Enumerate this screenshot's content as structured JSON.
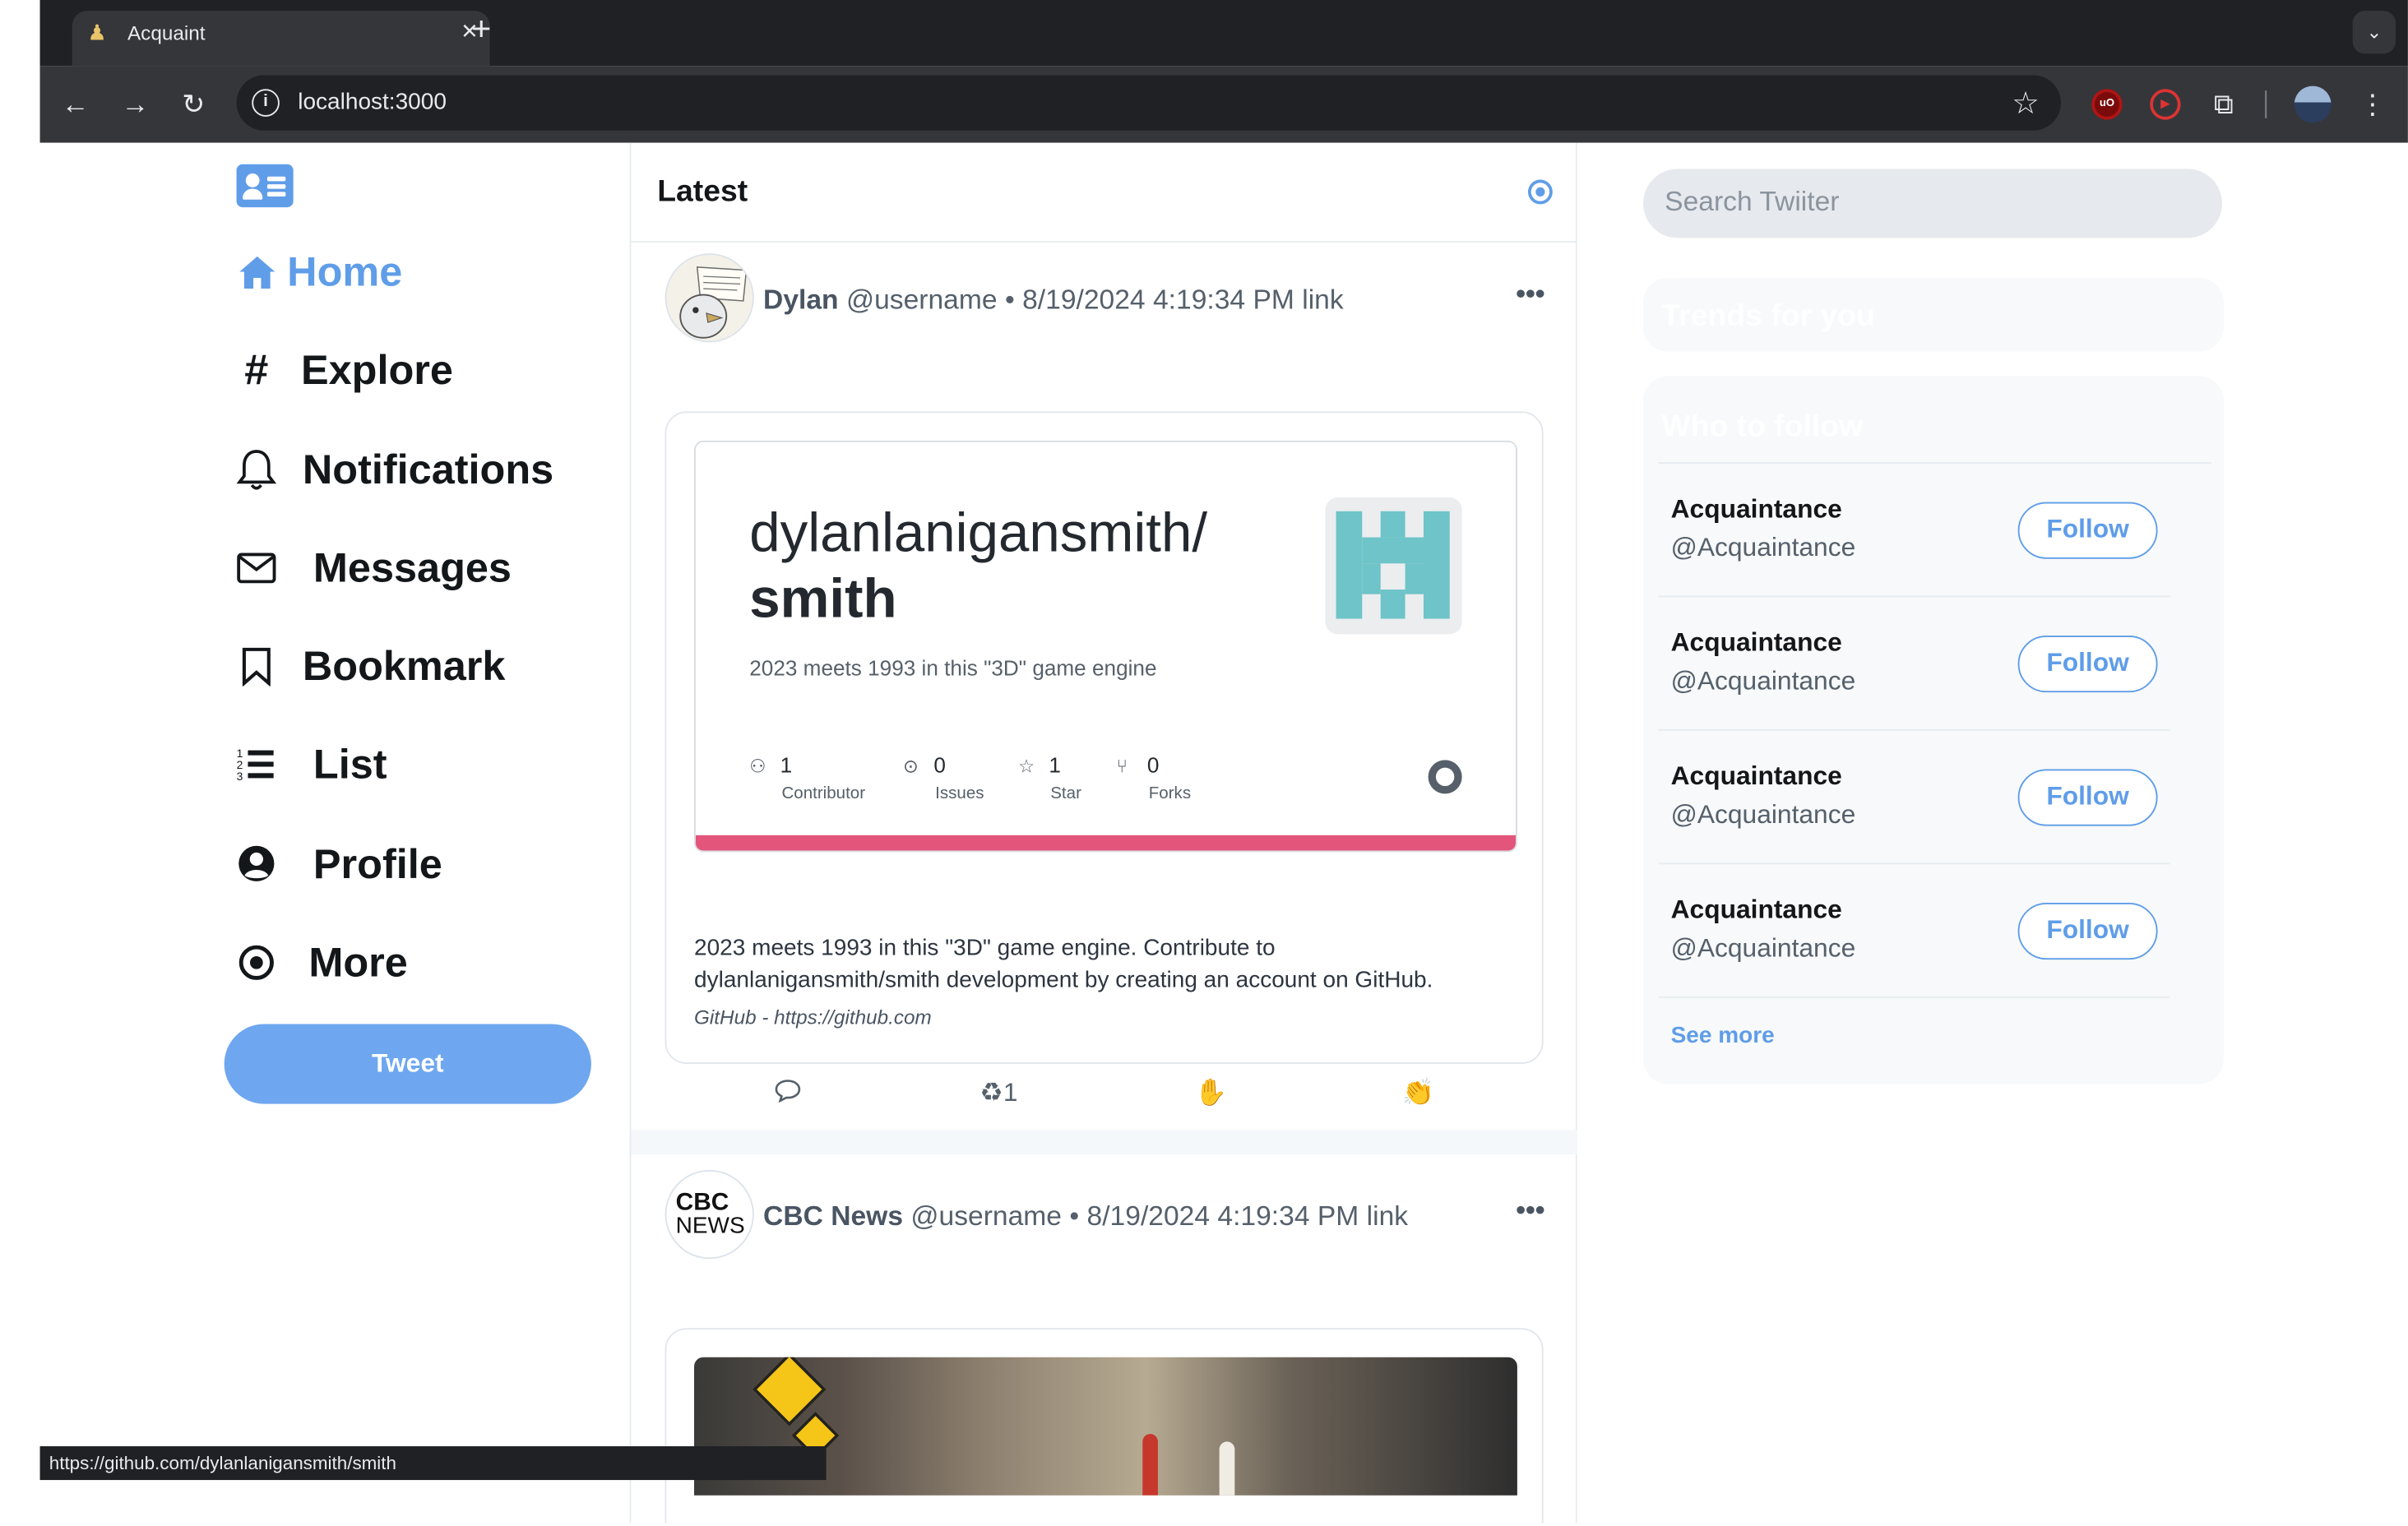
{
  "browser": {
    "tab_title": "Acquaint",
    "url": "localhost:3000",
    "status_url": "https://github.com/dylanlanigansmith/smith"
  },
  "nav": {
    "items": [
      {
        "label": "Home",
        "icon": "home-icon"
      },
      {
        "label": "Explore",
        "icon": "hashtag-icon"
      },
      {
        "label": "Notifications",
        "icon": "bell-icon"
      },
      {
        "label": "Messages",
        "icon": "envelope-icon"
      },
      {
        "label": "Bookmark",
        "icon": "bookmark-icon"
      },
      {
        "label": "List",
        "icon": "list-icon"
      },
      {
        "label": "Profile",
        "icon": "user-circle-icon"
      },
      {
        "label": "More",
        "icon": "more-circle-icon"
      }
    ],
    "tweet_label": "Tweet"
  },
  "feed": {
    "title": "Latest",
    "posts": [
      {
        "name": "Dylan",
        "handle": "@username",
        "dot": "•",
        "date": "8/19/2024 4:19:34 PM",
        "link": "link",
        "card": {
          "owner": "dylanlanigansmith/",
          "repo": "smith",
          "description": "2023 meets 1993 in this \"3D\" game engine",
          "stats": [
            {
              "value": "1",
              "label": "Contributor",
              "icon": "people-icon"
            },
            {
              "value": "0",
              "label": "Issues",
              "icon": "issue-icon"
            },
            {
              "value": "1",
              "label": "Star",
              "icon": "star-icon"
            },
            {
              "value": "0",
              "label": "Forks",
              "icon": "fork-icon"
            }
          ],
          "text": "2023 meets 1993 in this \"3D\" game engine. Contribute to dylanlanigansmith/smith development by creating an account on GitHub.",
          "source": "GitHub - https://github.com"
        },
        "actions": {
          "reply": "",
          "retweet_count": "1",
          "like": "",
          "clap": ""
        }
      },
      {
        "name": "CBC News",
        "handle": "@username",
        "dot": "•",
        "date": "8/19/2024 4:19:34 PM",
        "link": "link",
        "avatar_text_top": "CBC",
        "avatar_text_bottom": "NEWS"
      }
    ]
  },
  "sidebar": {
    "search_placeholder": "Search Twiiter",
    "trends_title": "Trends for you",
    "who_title": "Who to follow",
    "follow_rows": [
      {
        "name": "Acquaintance",
        "handle": "@Acquaintance",
        "button": "Follow"
      },
      {
        "name": "Acquaintance",
        "handle": "@Acquaintance",
        "button": "Follow"
      },
      {
        "name": "Acquaintance",
        "handle": "@Acquaintance",
        "button": "Follow"
      },
      {
        "name": "Acquaintance",
        "handle": "@Acquaintance",
        "button": "Follow"
      }
    ],
    "see_more": "See more"
  },
  "colors": {
    "accent": "#5f9de8",
    "tweet_button": "#6ea7f0",
    "repo_bar": "#e3557b",
    "logo_tile": "#6ec4c8"
  }
}
